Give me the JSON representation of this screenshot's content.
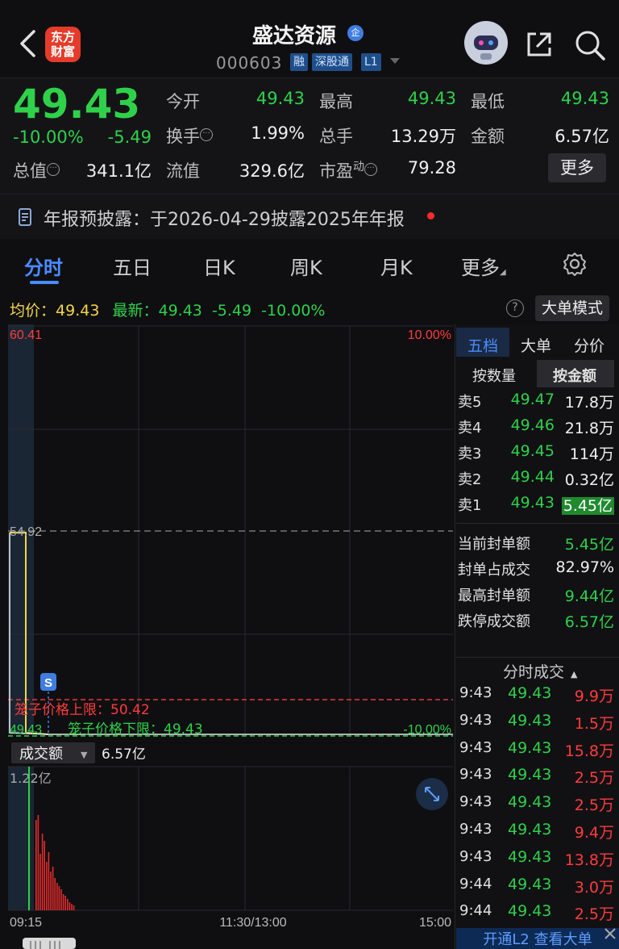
{
  "header": {
    "title": "盛达资源",
    "badge": "企",
    "logo_line1": "东方",
    "logo_line2": "财富",
    "code": "000603",
    "tags": [
      "融",
      "深股通",
      "L1"
    ]
  },
  "quote": {
    "price": "49.43",
    "pct": "-10.00%",
    "chg": "-5.49",
    "fields": {
      "open_label": "今开",
      "open": "49.43",
      "high_label": "最高",
      "high": "49.43",
      "low_label": "最低",
      "low": "49.43",
      "turnover_label": "换手",
      "turnover": "1.99%",
      "vol_label": "总手",
      "vol": "13.29万",
      "amount_label": "金额",
      "amount": "6.57亿",
      "mktcap_label": "总值",
      "mktcap": "341.1亿",
      "float_label": "流值",
      "float": "329.6亿",
      "pe_label": "市盈",
      "pe_sup": "动",
      "pe": "79.28"
    },
    "more_label": "更多"
  },
  "notice": {
    "text": "年报预披露：于2026-04-29披露2025年年报"
  },
  "tabs": [
    "分时",
    "五日",
    "日K",
    "周K",
    "月K",
    "更多"
  ],
  "avg_line": {
    "avg_label": "均价：",
    "avg": "49.43",
    "latest_label": "最新：",
    "latest": "49.43",
    "chg": "-5.49",
    "pct": "-10.00%"
  },
  "help_label": "?",
  "mode_label": "大单模式",
  "chart": {
    "y_top": "60.41",
    "pct_top": "10.00%",
    "prev_close": "54.92",
    "upper_limit_label": "笼子价格上限：50.42",
    "lower_limit_label": "笼子价格下限：49.43",
    "bottom_price": "49.43",
    "pct_bottom": "-10.00%",
    "s_marker": "S",
    "vol_selector": "成交额",
    "vol_total": "6.57亿",
    "vol_max": "1.22亿",
    "time_start": "09:15",
    "time_mid": "11:30/13:00",
    "time_end": "15:00"
  },
  "book": {
    "tabs": [
      "五档",
      "大单",
      "分价"
    ],
    "subtabs": [
      "按数量",
      "按金额"
    ],
    "asks": [
      {
        "label": "卖5",
        "price": "49.47",
        "vol": "17.8万"
      },
      {
        "label": "卖4",
        "price": "49.46",
        "vol": "21.8万"
      },
      {
        "label": "卖3",
        "price": "49.45",
        "vol": "114万"
      },
      {
        "label": "卖2",
        "price": "49.44",
        "vol": "0.32亿"
      },
      {
        "label": "卖1",
        "price": "49.43",
        "vol": "5.45亿"
      }
    ],
    "seal": [
      {
        "label": "当前封单额",
        "value": "5.45亿",
        "color": "green"
      },
      {
        "label": "封单占成交",
        "value": "82.97%",
        "color": "white"
      },
      {
        "label": "最高封单额",
        "value": "9.44亿",
        "color": "green"
      },
      {
        "label": "跌停成交额",
        "value": "6.57亿",
        "color": "green"
      }
    ],
    "trades_title": "分时成交",
    "trades": [
      {
        "time": "9:43",
        "price": "49.43",
        "vol": "9.9万"
      },
      {
        "time": "9:43",
        "price": "49.43",
        "vol": "1.5万"
      },
      {
        "time": "9:43",
        "price": "49.43",
        "vol": "15.8万"
      },
      {
        "time": "9:43",
        "price": "49.43",
        "vol": "2.5万"
      },
      {
        "time": "9:43",
        "price": "49.43",
        "vol": "2.5万"
      },
      {
        "time": "9:43",
        "price": "49.43",
        "vol": "9.4万"
      },
      {
        "time": "9:43",
        "price": "49.43",
        "vol": "13.8万"
      },
      {
        "time": "9:44",
        "price": "49.43",
        "vol": "3.0万"
      },
      {
        "time": "9:44",
        "price": "49.43",
        "vol": "2.5万"
      }
    ],
    "open_l2": "开通L2 查看大单"
  },
  "colors": {
    "up": "#ff3b3b",
    "down": "#2fd14a",
    "accent": "#4a8cff"
  }
}
